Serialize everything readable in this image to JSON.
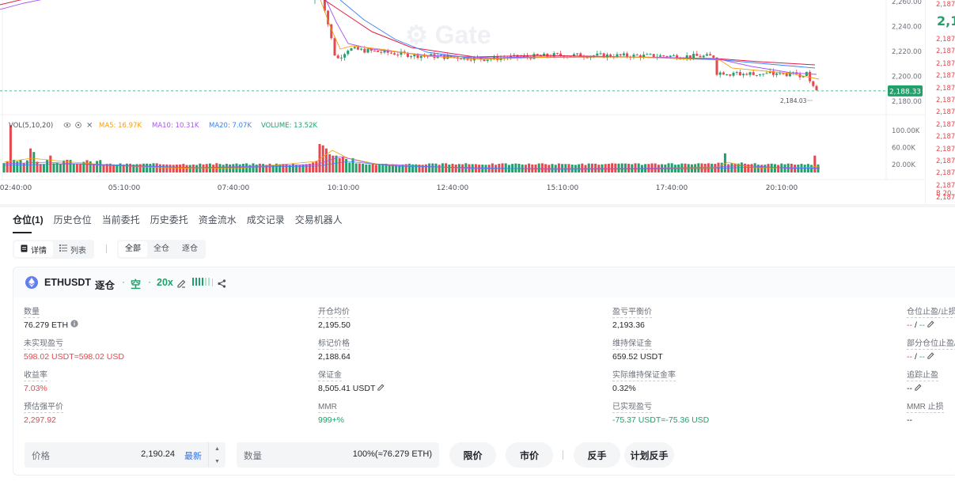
{
  "chart": {
    "price_ticks": [
      "2,260.00",
      "2,240.00",
      "2,220.00",
      "2,200.00",
      "2,180.00"
    ],
    "current_price_tag": "2,188.33",
    "low_marker": "2,184.03",
    "volume_ticks": [
      "100.00K",
      "60.00K",
      "20.00K"
    ],
    "time_ticks": [
      "02:40:00",
      "05:10:00",
      "07:40:00",
      "10:10:00",
      "12:40:00",
      "15:10:00",
      "17:40:00",
      "20:10:00"
    ],
    "volume_legend": {
      "title": "VOL(5,10,20)",
      "ma5": "MA5: 16.97K",
      "ma10": "MA10: 10.31K",
      "ma20": "MA20: 7.07K",
      "volume": "VOLUME: 13.52K"
    },
    "colors": {
      "up": "#22a06b",
      "down": "#e5484d",
      "ma5": "#f59e0b",
      "ma10": "#a855f7",
      "ma20": "#3b82f6",
      "ma_long": "#e11d48"
    }
  },
  "right_panel": {
    "top_price": "2,187",
    "big_price": "2,1",
    "price_rows": [
      "2,187",
      "2,187",
      "2,187",
      "2,187",
      "2,187",
      "2,187",
      "2,187",
      "2,187",
      "2,187",
      "2,187",
      "2,187",
      "2,187",
      "2,187",
      "2,187"
    ],
    "bottom_label": "B 20."
  },
  "tabs": [
    "仓位(1)",
    "历史仓位",
    "当前委托",
    "历史委托",
    "资金流水",
    "成交记录",
    "交易机器人"
  ],
  "view_toggle": {
    "detail": "详情",
    "list": "列表"
  },
  "filter_toggle": [
    "全部",
    "全仓",
    "逐仓"
  ],
  "position": {
    "symbol": "ETHUSDT",
    "margin_mode": "逐仓",
    "side": "空",
    "leverage": "20x",
    "fields": {
      "qty": {
        "label": "数量",
        "value": "76.279 ETH"
      },
      "unrealized_pnl": {
        "label": "未实现盈亏",
        "value": "598.02 USDT=598.02 USD"
      },
      "roe": {
        "label": "收益率",
        "value": "7.03%"
      },
      "est_liq_price": {
        "label": "预估强平价",
        "value": "2,297.92"
      },
      "avg_open_price": {
        "label": "开仓均价",
        "value": "2,195.50"
      },
      "mark_price": {
        "label": "标记价格",
        "value": "2,188.64"
      },
      "margin": {
        "label": "保证金",
        "value": "8,505.41 USDT"
      },
      "mmr": {
        "label": "MMR",
        "value": "999+%"
      },
      "breakeven_price": {
        "label": "盈亏平衡价",
        "value": "2,193.36"
      },
      "maint_margin": {
        "label": "维持保证金",
        "value": "659.52 USDT"
      },
      "actual_mmr": {
        "label": "实际维持保证金率",
        "value": "0.32%"
      },
      "realized_pnl": {
        "label": "已实现盈亏",
        "value": "-75.37 USDT=-75.36 USD"
      },
      "tp_sl": {
        "label": "仓位止盈/止损",
        "value_a": "--",
        "sep": "/",
        "value_b": "--"
      },
      "partial_tp_sl": {
        "label": "部分仓位止盈/",
        "value_a": "--",
        "sep": "/",
        "value_b": "--"
      },
      "trailing_tp": {
        "label": "追踪止盈",
        "value": "--"
      },
      "mmr_sl": {
        "label": "MMR 止损",
        "value": "--"
      }
    }
  },
  "order_bar": {
    "price_label": "价格",
    "price_value": "2,190.24",
    "price_latest": "最新",
    "qty_label": "数量",
    "qty_value": "100%(≈76.279 ETH)",
    "btn_limit": "限价",
    "btn_market": "市价",
    "btn_reverse": "反手",
    "btn_plan_reverse": "计划反手"
  }
}
